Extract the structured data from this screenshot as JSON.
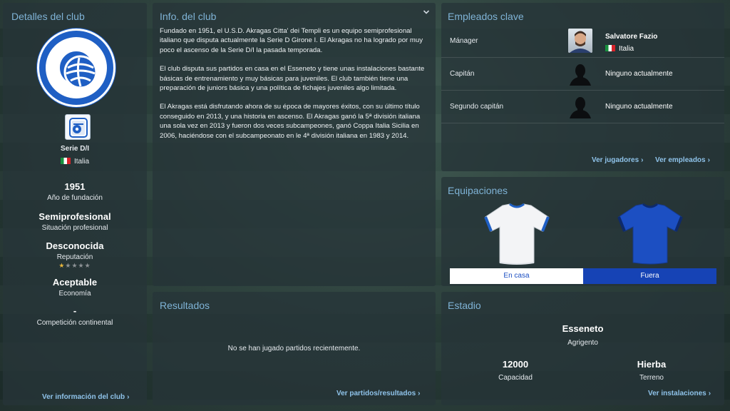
{
  "details": {
    "title": "Detalles del club",
    "league": "Serie D/I",
    "nation": "Italia",
    "founded_value": "1951",
    "founded_label": "Año de fundación",
    "status_value": "Semiprofesional",
    "status_label": "Situación profesional",
    "reputation_value": "Desconocida",
    "reputation_label": "Reputación",
    "reputation_stars": 0.5,
    "economy_value": "Aceptable",
    "economy_label": "Economía",
    "continental_value": "-",
    "continental_label": "Competición continental",
    "link": "Ver información del club"
  },
  "info": {
    "title": "Info. del club",
    "paragraphs": [
      "Fundado en 1951, el U.S.D. Akragas Citta' dei Templi es un equipo semiprofesional italiano que disputa actualmente la Serie D Girone I. El Akragas no ha logrado por muy poco el ascenso de la Serie D/I la pasada temporada.",
      "El club disputa sus partidos en casa en el Esseneto y tiene unas instalaciones bastante básicas de entrenamiento y muy básicas para juveniles. El club también tiene una preparación de juniors básica y una política de fichajes juveniles algo limitada.",
      "El Akragas está disfrutando ahora de su época de mayores éxitos, con su último título conseguido en 2013, y una historia en ascenso. El Akragas ganó la 5ª división italiana una sola vez en 2013 y fueron dos veces subcampeones, ganó Coppa Italia Sicilia en 2006, haciéndose con el subcampeonato en le 4ª división italiana en 1983 y 2014."
    ]
  },
  "results": {
    "title": "Resultados",
    "empty": "No se han jugado partidos recientemente.",
    "link": "Ver partidos/resultados"
  },
  "staff": {
    "title": "Empleados clave",
    "rows": [
      {
        "role": "Mánager",
        "name": "Salvatore Fazio",
        "nation": "Italia"
      },
      {
        "role": "Capitán",
        "name": "Ninguno actualmente"
      },
      {
        "role": "Segundo capitán",
        "name": "Ninguno actualmente"
      }
    ],
    "link_players": "Ver jugadores",
    "link_staff": "Ver empleados"
  },
  "kits": {
    "title": "Equipaciones",
    "home_label": "En casa",
    "away_label": "Fuera",
    "home_color": "#f4f4f4",
    "away_color": "#1c4fc2",
    "trim_color": "#1f5fc4"
  },
  "stadium": {
    "title": "Estadio",
    "name": "Esseneto",
    "city": "Agrigento",
    "capacity_value": "12000",
    "capacity_label": "Capacidad",
    "surface_value": "Hierba",
    "surface_label": "Terreno",
    "link": "Ver instalaciones"
  }
}
